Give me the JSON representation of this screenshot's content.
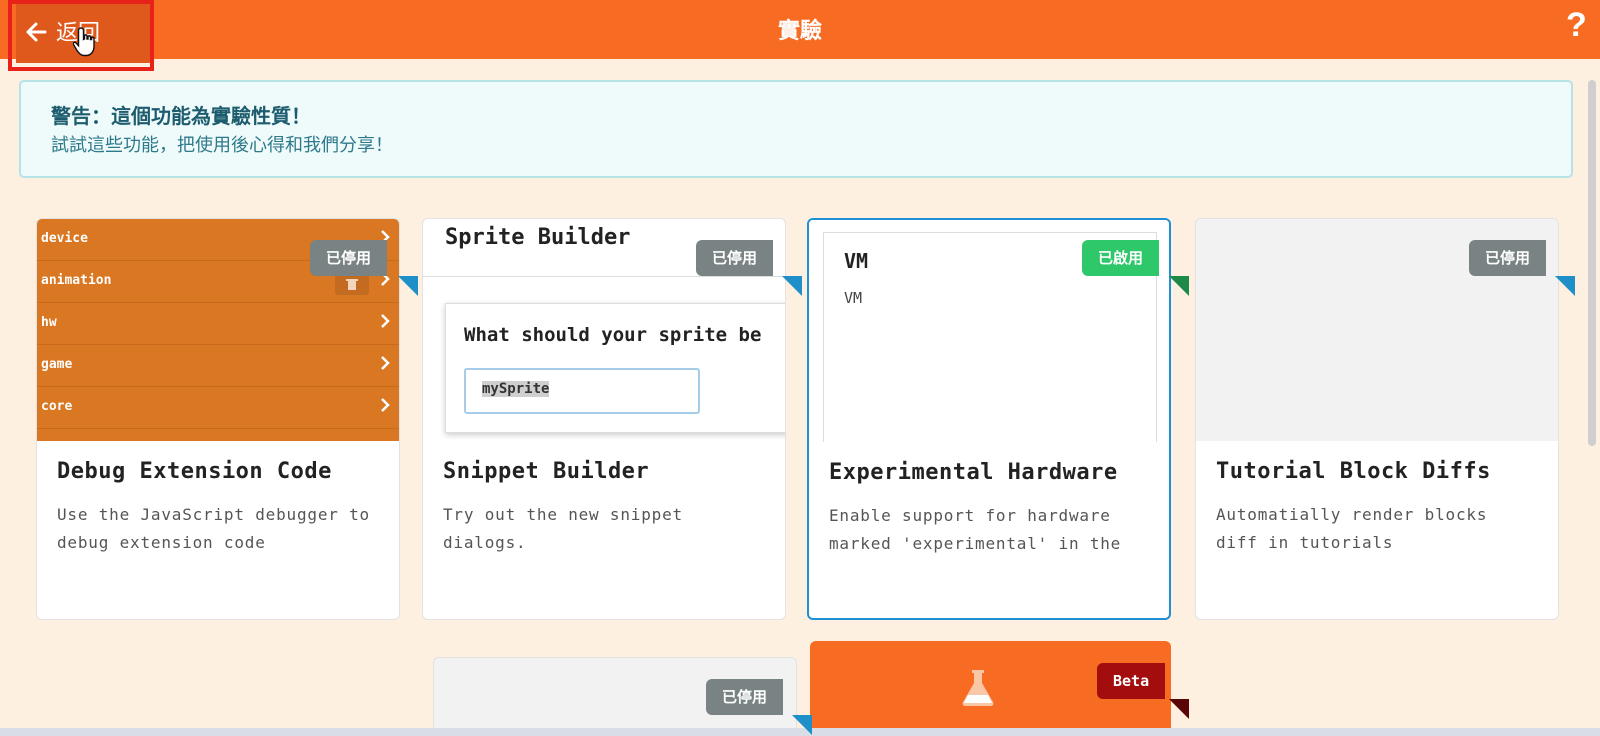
{
  "header": {
    "back_label": "返回",
    "title": "實驗",
    "help_label": "?"
  },
  "warning": {
    "title": "警告：這個功能為實驗性質！",
    "body": "試試這些功能，把使用後心得和我們分享！"
  },
  "cards": [
    {
      "title": "Debug Extension Code",
      "description": "Use the JavaScript debugger to debug extension code",
      "status": "已停用",
      "preview": {
        "extensions": [
          "device",
          "animation",
          "hw",
          "game",
          "core"
        ]
      }
    },
    {
      "title": "Snippet Builder",
      "description": "Try out the new snippet dialogs.",
      "status": "已停用",
      "preview": {
        "header": "Sprite Builder",
        "question": "What should your sprite be",
        "input_value": "mySprite"
      }
    },
    {
      "title": "Experimental Hardware",
      "description": "Enable support for hardware marked 'experimental' in the",
      "status": "已啟用",
      "preview": {
        "title": "VM",
        "subtitle": "VM"
      }
    },
    {
      "title": "Tutorial Block Diffs",
      "description": "Automatially render blocks diff in tutorials",
      "status": "已停用"
    }
  ],
  "bottom_cards": [
    {
      "status": "已停用"
    },
    {
      "badge": "Beta",
      "icon": "flask-icon"
    }
  ],
  "colors": {
    "header": "#f76b23",
    "disabled_ribbon": "#798383",
    "enabled_ribbon": "#2ec76a",
    "beta_ribbon": "#a30d0d",
    "selected_border": "#1f8fd6"
  }
}
